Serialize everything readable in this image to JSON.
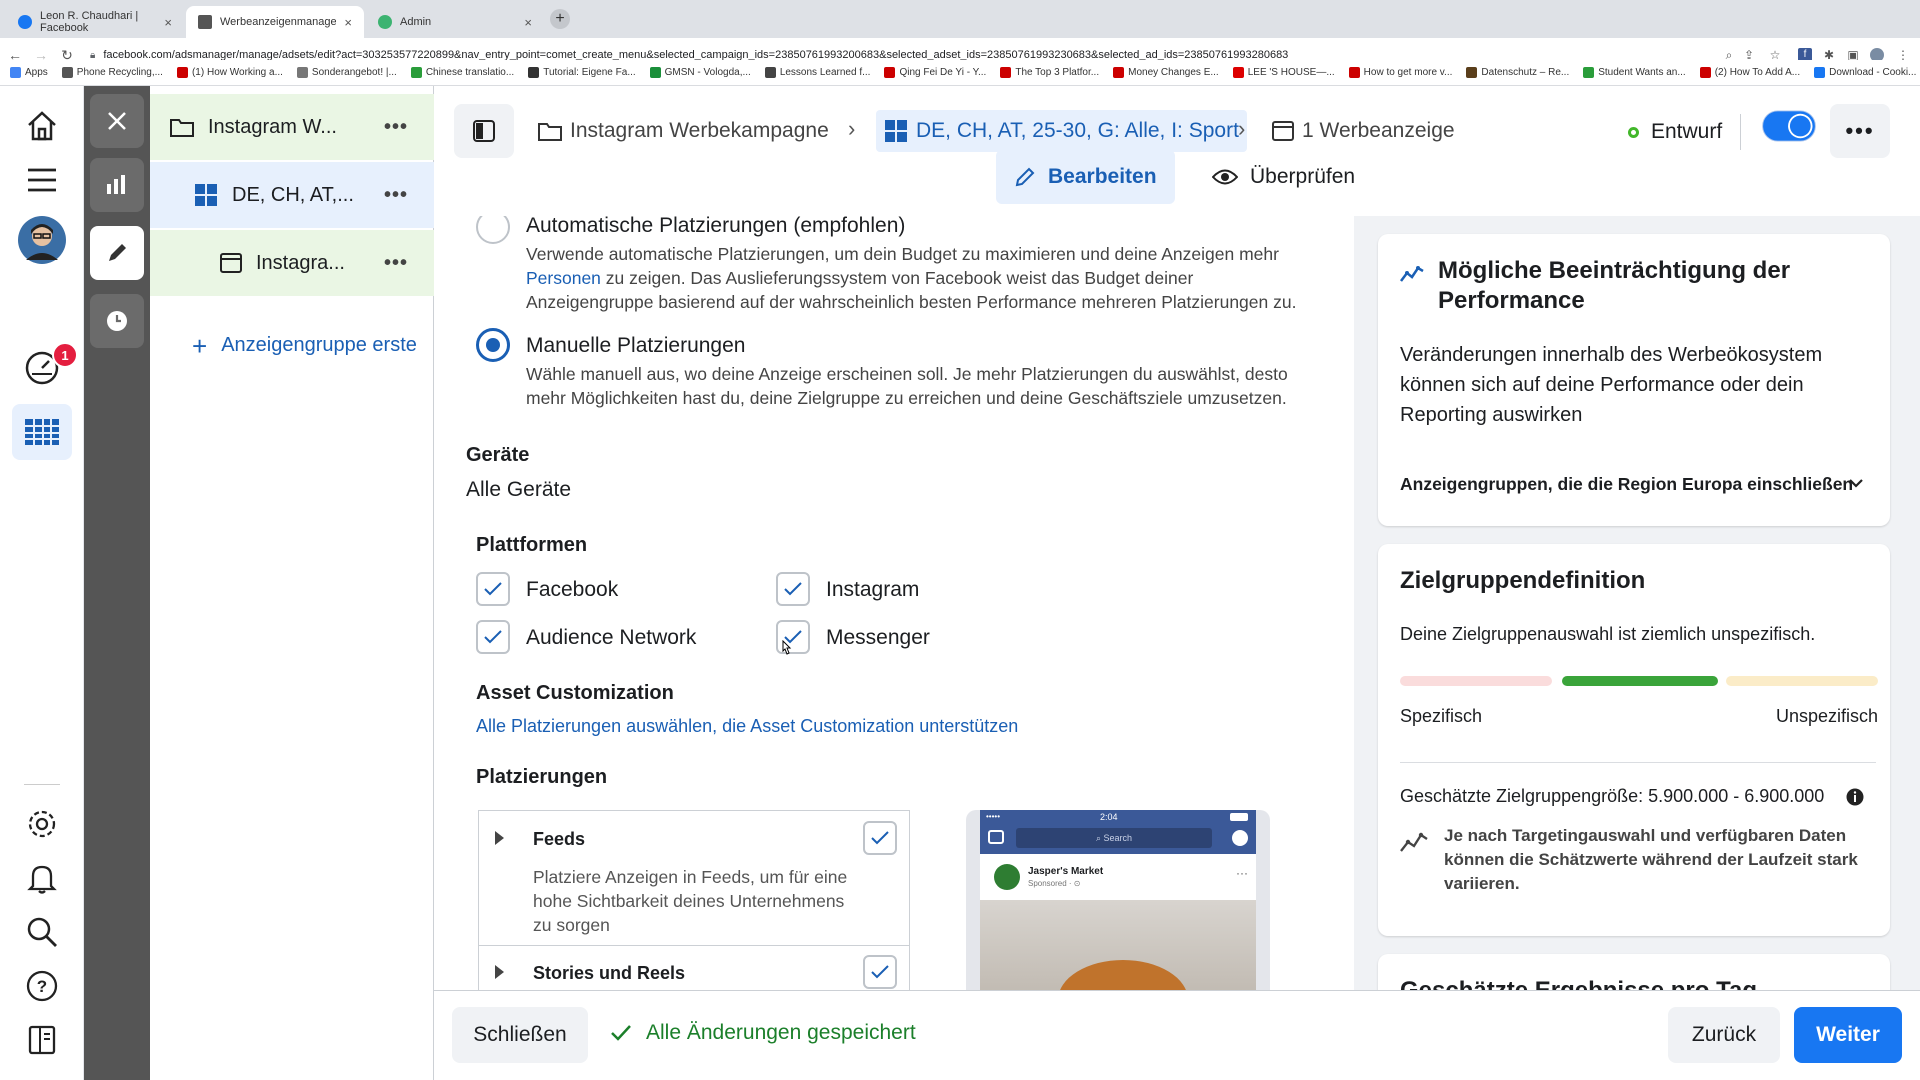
{
  "browser": {
    "tabs": [
      {
        "title": "Leon R. Chaudhari | Facebook",
        "color": "#1877f2"
      },
      {
        "title": "Werbeanzeigenmanager - Wer",
        "color": "#555555"
      },
      {
        "title": "Admin",
        "color": "#3cb371"
      }
    ],
    "url": "facebook.com/adsmanager/manage/adsets/edit?act=303253577220899&nav_entry_point=comet_create_menu&selected_campaign_ids=23850761993200683&selected_adset_ids=23850761993230683&selected_ad_ids=23850761993280683",
    "bookmarks": [
      "Apps",
      "Phone Recycling,...",
      "(1) How Working a...",
      "Sonderangebot! |...",
      "Chinese translatio...",
      "Tutorial: Eigene Fa...",
      "GMSN - Vologda,...",
      "Lessons Learned f...",
      "Qing Fei De Yi - Y...",
      "The Top 3 Platfor...",
      "Money Changes E...",
      "LEE 'S HOUSE—...",
      "How to get more v...",
      "Datenschutz – Re...",
      "Student Wants an...",
      "(2) How To Add A...",
      "Download - Cooki..."
    ]
  },
  "rail": {
    "notification_count": "1"
  },
  "tree": {
    "campaign": "Instagram W...",
    "adset": "DE, CH, AT,...",
    "ad": "Instagra...",
    "add_adset": "Anzeigengruppe erste",
    "more": "•••"
  },
  "header": {
    "crumb_campaign": "Instagram Werbekampagne",
    "crumb_adset": "DE, CH, AT, 25-30, G: Alle, I: Sport",
    "crumb_ad": "1 Werbeanzeige",
    "status": "Entwurf",
    "more": "•••",
    "tab_edit": "Bearbeiten",
    "tab_review": "Überprüfen"
  },
  "placements": {
    "auto_title": "Automatische Platzierungen (empfohlen)",
    "auto_desc_1": "Verwende automatische Platzierungen, um dein Budget zu maximieren und deine Anzeigen mehr",
    "auto_desc_link": "Personen",
    "auto_desc_2": " zu zeigen. Das Auslieferungssystem von Facebook weist das Budget deiner",
    "auto_desc_3": "Anzeigengruppe basierend auf der wahrscheinlich besten Performance mehreren Platzierungen zu.",
    "manual_title": "Manuelle Platzierungen",
    "manual_desc_1": "Wähle manuell aus, wo deine Anzeige erscheinen soll. Je mehr Platzierungen du auswählst, desto",
    "manual_desc_2": "mehr Möglichkeiten hast du, deine Zielgruppe zu erreichen und deine Geschäftsziele umzusetzen.",
    "devices_label": "Geräte",
    "devices_value": "Alle Geräte",
    "platforms_label": "Plattformen",
    "platforms": [
      "Facebook",
      "Instagram",
      "Audience Network",
      "Messenger"
    ],
    "asset_label": "Asset Customization",
    "asset_link": "Alle Platzierungen auswählen, die Asset Customization unterstützen",
    "placements_label": "Platzierungen",
    "feeds_title": "Feeds",
    "feeds_desc_1": "Platziere Anzeigen in Feeds, um für eine",
    "feeds_desc_2": "hohe Sichtbarkeit deines Unternehmens",
    "feeds_desc_3": "zu sorgen",
    "stories_title": "Stories und Reels"
  },
  "preview": {
    "time": "2:04",
    "search": "Search",
    "page": "Jasper's Market",
    "sponsored": "Sponsored · ⊙",
    "signal": "•••••"
  },
  "right": {
    "perf_title_1": "Mögliche Beeinträchtigung der",
    "perf_title_2": "Performance",
    "perf_text_1": "Veränderungen innerhalb des Werbeökosystem",
    "perf_text_2": "können sich auf deine Performance oder dein",
    "perf_text_3": "Reporting auswirken",
    "perf_expand": "Anzeigengruppen, die die Region Europa einschließen",
    "aud_title": "Zielgruppendefinition",
    "aud_text": "Deine Zielgruppenauswahl ist ziemlich unspezifisch.",
    "aud_left": "Spezifisch",
    "aud_right": "Unspezifisch",
    "aud_size": "Geschätzte Zielgruppengröße: 5.900.000 - 6.900.000",
    "aud_note_1": "Je nach Targetingauswahl und verfügbaren Daten",
    "aud_note_2": "können die Schätzwerte während der Laufzeit stark",
    "aud_note_3": "variieren.",
    "next_card_title": "Geschätzte Ergebnisse pro Tag"
  },
  "footer": {
    "close": "Schließen",
    "saved": "Alle Änderungen gespeichert",
    "back": "Zurück",
    "next": "Weiter"
  },
  "colors": {
    "accent": "#1877f2",
    "link": "#1a5fb4",
    "success": "#42b72a",
    "danger": "#e41e3f"
  }
}
